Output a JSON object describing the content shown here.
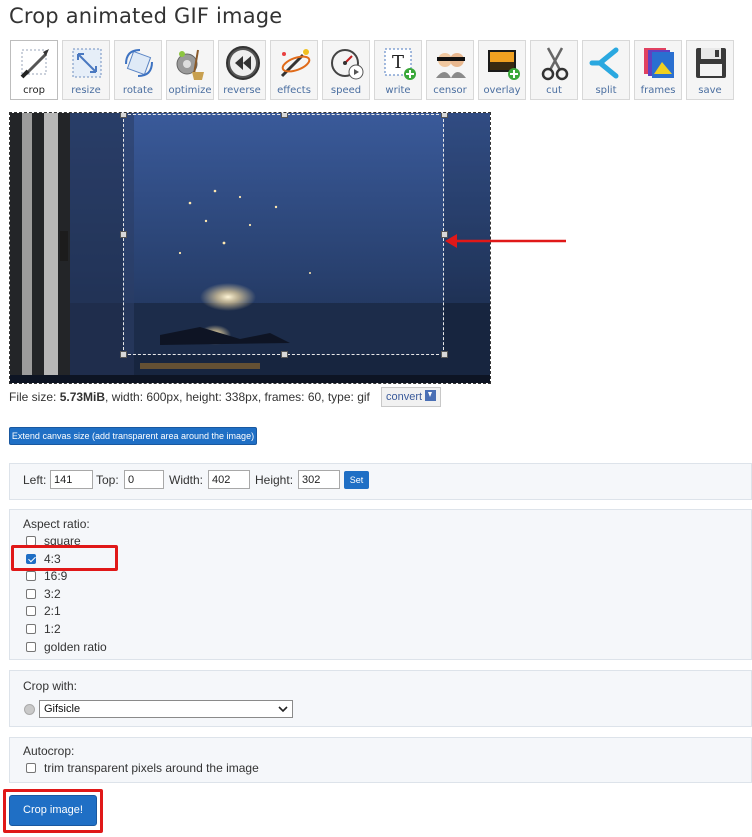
{
  "page": {
    "title": "Crop animated GIF image"
  },
  "toolbar": {
    "tools": [
      {
        "label": "crop",
        "icon": "crop-icon",
        "active": true
      },
      {
        "label": "resize",
        "icon": "resize-icon"
      },
      {
        "label": "rotate",
        "icon": "rotate-icon"
      },
      {
        "label": "optimize",
        "icon": "optimize-icon"
      },
      {
        "label": "reverse",
        "icon": "reverse-icon"
      },
      {
        "label": "effects",
        "icon": "effects-icon"
      },
      {
        "label": "speed",
        "icon": "speed-icon"
      },
      {
        "label": "write",
        "icon": "write-icon"
      },
      {
        "label": "censor",
        "icon": "censor-icon"
      },
      {
        "label": "overlay",
        "icon": "overlay-icon"
      },
      {
        "label": "cut",
        "icon": "scissors-icon"
      },
      {
        "label": "split",
        "icon": "split-icon"
      },
      {
        "label": "frames",
        "icon": "frames-icon"
      },
      {
        "label": "save",
        "icon": "save-icon"
      }
    ]
  },
  "file_info": {
    "prefix": "File size: ",
    "size": "5.73MiB",
    "rest": ", width: 600px, height: 338px, frames: 60, type: gif",
    "convert_label": "convert"
  },
  "extend_button": "Extend canvas size (add transparent area around the image)",
  "crop_fields": {
    "left_label": "Left:",
    "left_value": "141",
    "top_label": "Top:",
    "top_value": "0",
    "width_label": "Width:",
    "width_value": "402",
    "height_label": "Height:",
    "height_value": "302",
    "set_label": "Set"
  },
  "aspect_ratio": {
    "label": "Aspect ratio:",
    "options": [
      {
        "label": "square",
        "checked": false
      },
      {
        "label": "4:3",
        "checked": true
      },
      {
        "label": "16:9",
        "checked": false
      },
      {
        "label": "3:2",
        "checked": false
      },
      {
        "label": "2:1",
        "checked": false
      },
      {
        "label": "1:2",
        "checked": false
      },
      {
        "label": "golden ratio",
        "checked": false
      }
    ]
  },
  "crop_with": {
    "label": "Crop with:",
    "selected": "Gifsicle"
  },
  "autocrop": {
    "label": "Autocrop:",
    "option": "trim transparent pixels around the image",
    "checked": false
  },
  "crop_button": "Crop image!",
  "colors": {
    "accent": "#1f6fc5",
    "highlight": "#e01818",
    "panel_bg": "#f5f7fa"
  }
}
